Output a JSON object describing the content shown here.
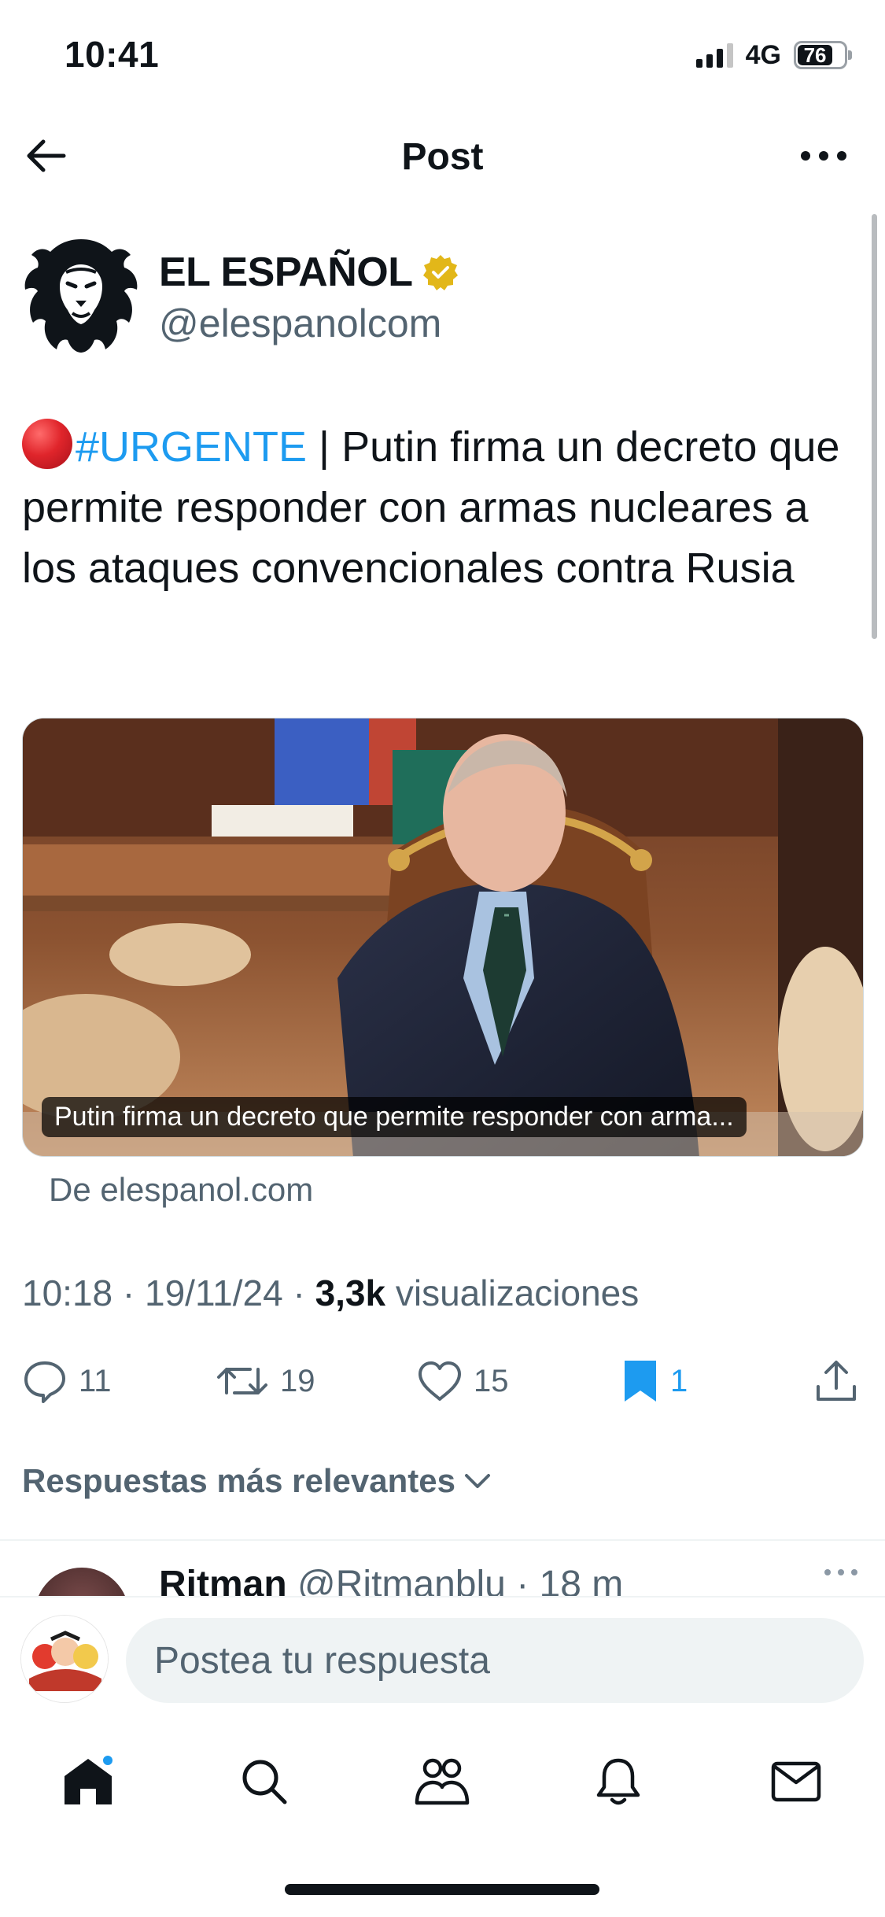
{
  "status_bar": {
    "time": "10:41",
    "network": "4G",
    "battery": "76"
  },
  "header": {
    "title": "Post",
    "back_icon": "arrow-left-icon",
    "more_icon": "more-horizontal-icon"
  },
  "author": {
    "name": "EL ESPAÑOL",
    "handle": "@elespanolcom",
    "verified_badge": "gold-verified-badge-icon"
  },
  "tweet": {
    "hashtag": "#URGENTE",
    "text": " | Putin firma un decreto que permite responder con armas nucleares a los ataques convencionales contra Rusia",
    "emoji": "red-circle-icon"
  },
  "media": {
    "caption": "Putin firma un decreto que permite responder con arma...",
    "source": "De elespanol.com"
  },
  "meta": {
    "time": "10:18",
    "date": "19/11/24",
    "views_count": "3,3k",
    "views_label": "visualizaciones"
  },
  "actions": {
    "replies": "11",
    "reposts": "19",
    "likes": "15",
    "bookmarks": "1"
  },
  "replies_section": {
    "sort_label": "Respuestas más relevantes",
    "first_reply": {
      "name": "Ritman",
      "handle": "@Ritmanblu · 18 m"
    }
  },
  "composer": {
    "placeholder": "Postea tu respuesta"
  },
  "colors": {
    "accent": "#1d9bf0",
    "text": "#0f1419",
    "secondary": "#536471",
    "gold_badge": "#e2b719"
  }
}
